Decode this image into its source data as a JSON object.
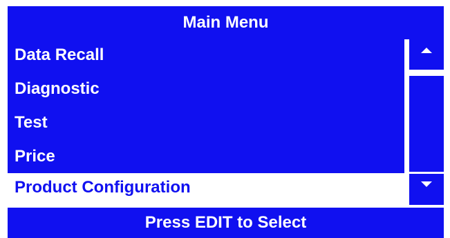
{
  "header": {
    "title": "Main Menu"
  },
  "menu": {
    "items": [
      {
        "label": "Data Recall"
      },
      {
        "label": "Diagnostic"
      },
      {
        "label": "Test"
      },
      {
        "label": "Price"
      }
    ],
    "selected_label": "Product Configuration"
  },
  "scroll": {
    "up_icon": "triangle-up",
    "down_icon": "triangle-down"
  },
  "footer": {
    "hint": "Press EDIT to Select"
  },
  "colors": {
    "accent": "#1010f0",
    "text_on_accent": "#ffffff",
    "background": "#ffffff"
  }
}
